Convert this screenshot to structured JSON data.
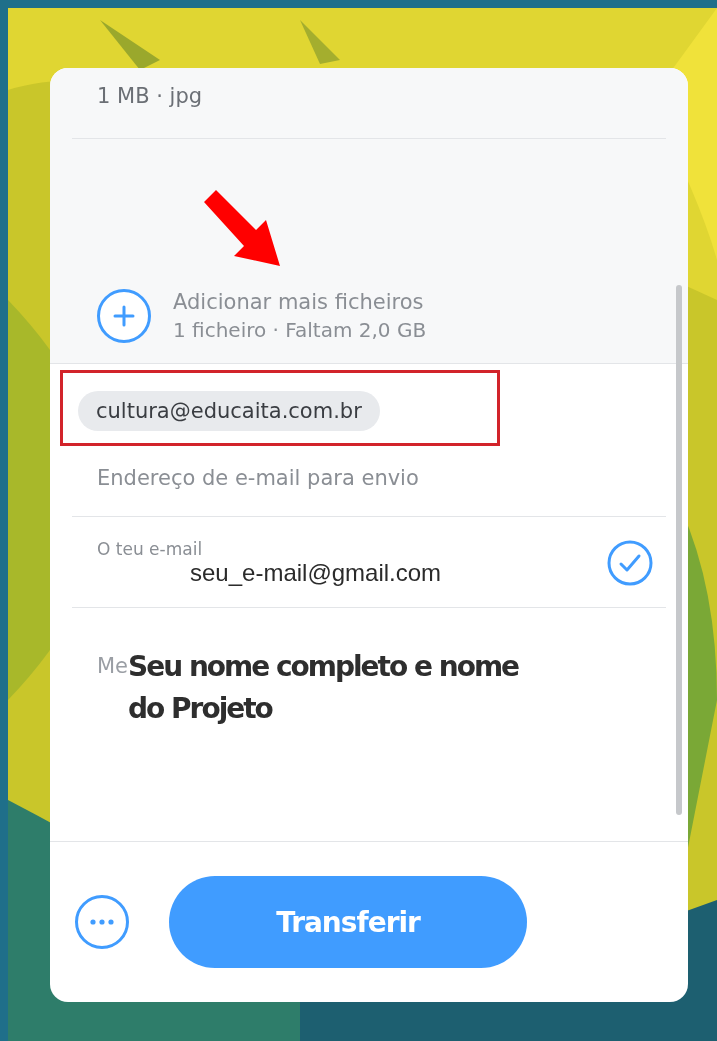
{
  "file": {
    "meta": "1 MB · jpg"
  },
  "add_files": {
    "title": "Adicionar mais ficheiros",
    "subtitle": "1 ficheiro · Faltam 2,0 GB"
  },
  "recipients": {
    "chips": [
      "cultura@educaita.com.br"
    ],
    "placeholder": "Endereço de e-mail para envio"
  },
  "sender": {
    "label": "O teu e-mail",
    "value": "seu_e-mail@gmail.com",
    "verified": true
  },
  "message": {
    "label": "Me",
    "note": "Seu nome completo e nome do Projeto"
  },
  "actions": {
    "submit": "Transferir"
  }
}
